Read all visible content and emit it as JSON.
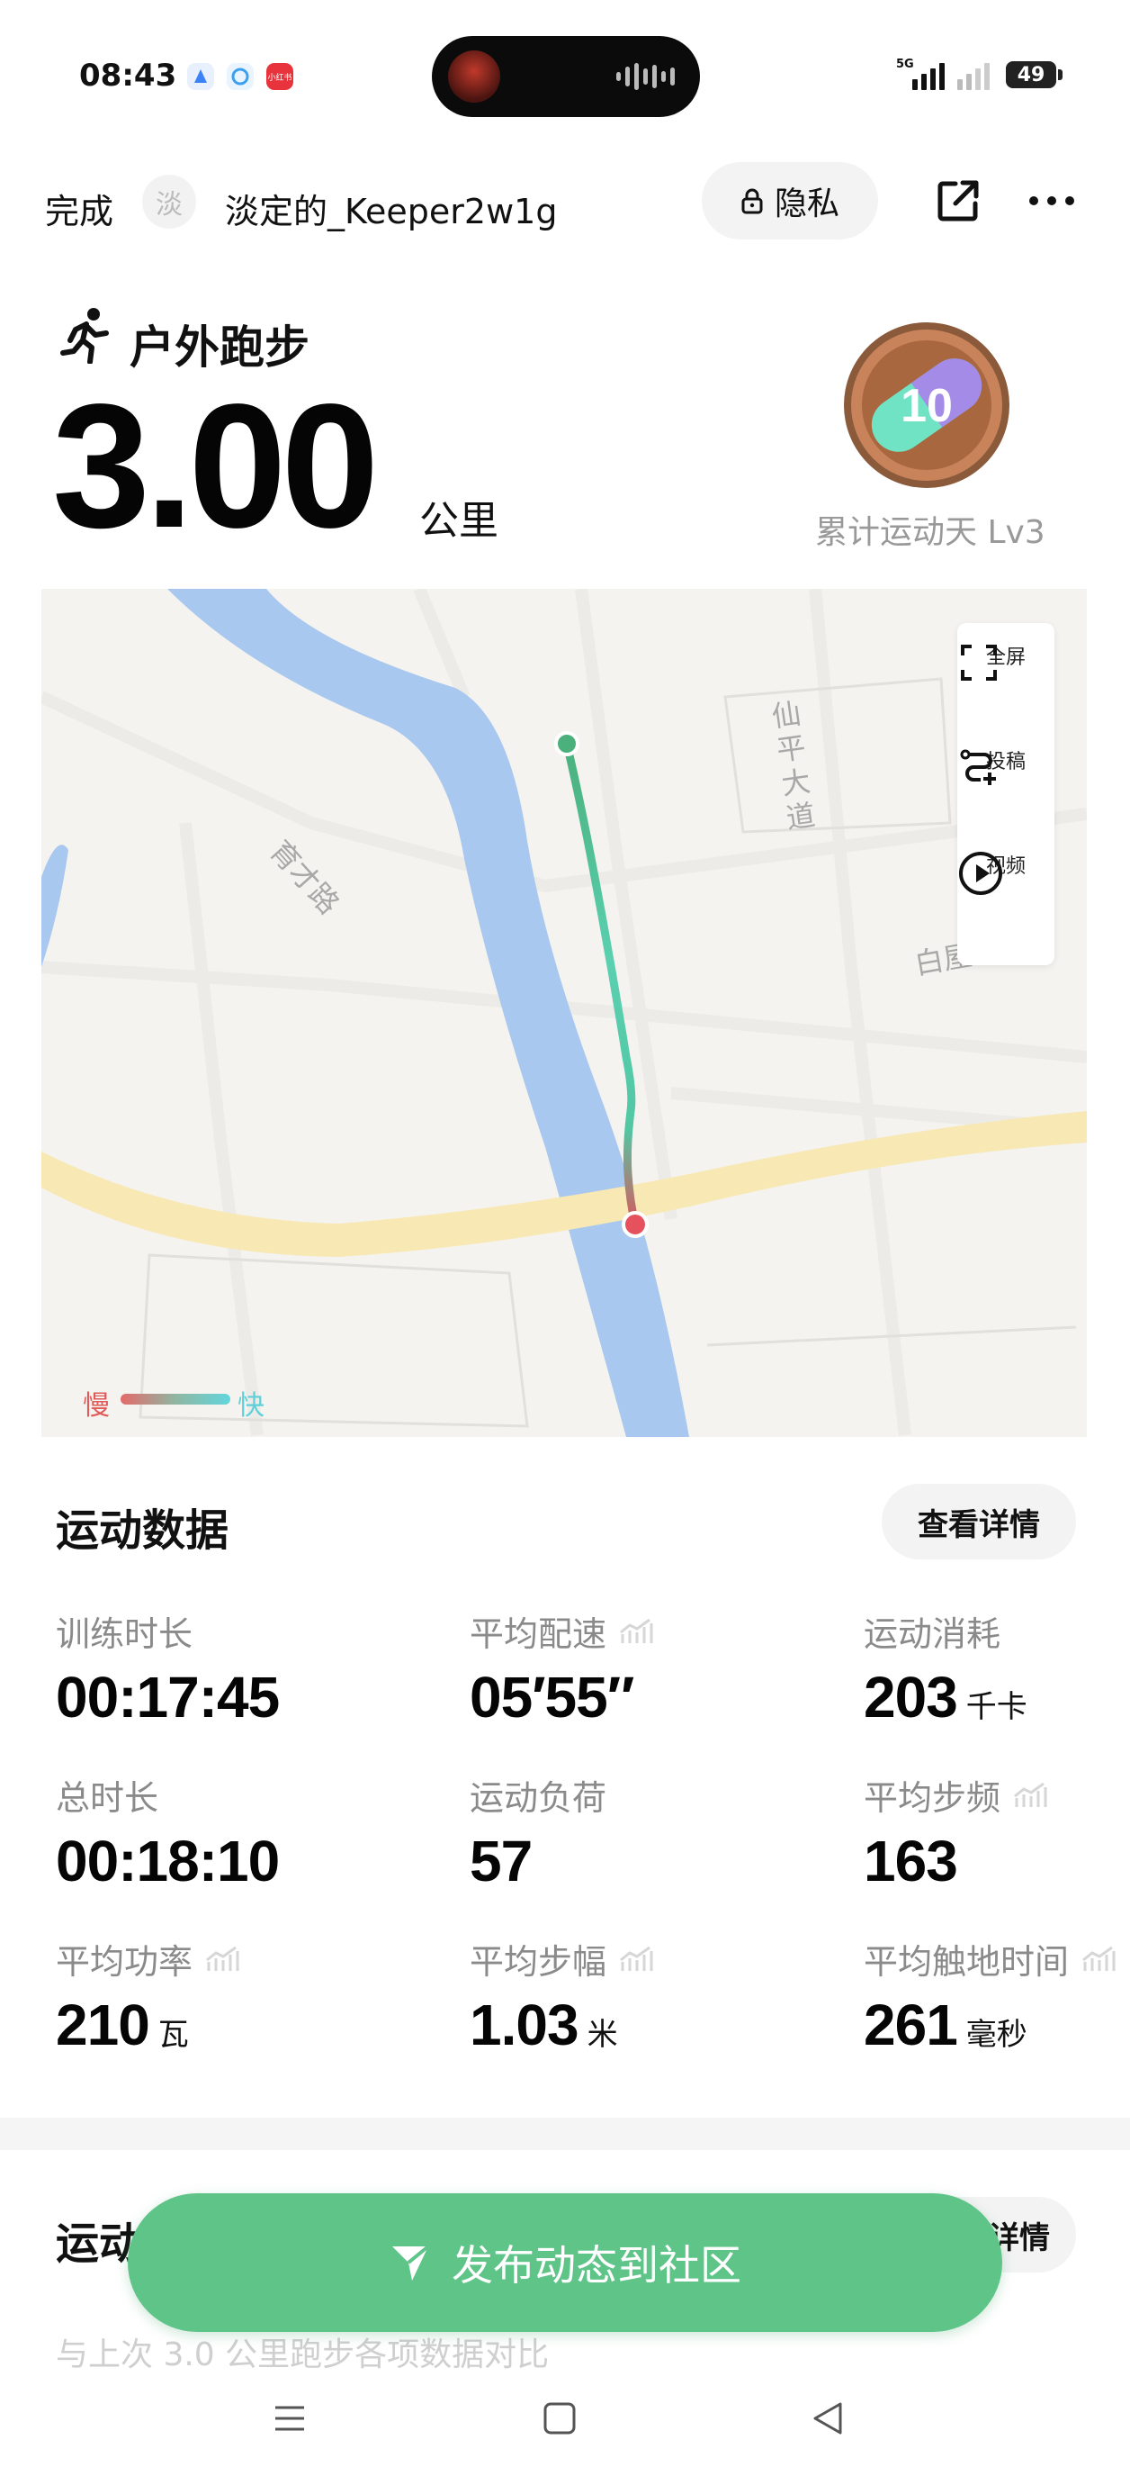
{
  "status_bar": {
    "time": "08:43",
    "network": "5G",
    "battery": "49",
    "app_icons": [
      "blue-app-icon",
      "circle-app-icon",
      "xiaohongshu-icon"
    ],
    "xhs_label": "小红书"
  },
  "nav": {
    "done_label": "完成",
    "avatar_char": "淡",
    "username": "淡定的_Keeper2w1g",
    "privacy_label": "隐私"
  },
  "workout": {
    "type_label": "户外跑步",
    "distance": "3.00",
    "distance_unit": "公里",
    "medal_label": "累计运动天 Lv3",
    "medal_text": "10"
  },
  "map": {
    "road_labels": [
      "仙平大道",
      "育才路",
      "白屋路"
    ],
    "controls": [
      "全屏",
      "投稿",
      "视频"
    ],
    "legend_slow": "慢",
    "legend_fast": "快",
    "colors": {
      "river": "#a8c8ef",
      "main_road": "#f7e8b4",
      "route_start": "#49b27a",
      "route_end": "#e5525d"
    }
  },
  "stats": {
    "section_title": "运动数据",
    "detail_label": "查看详情",
    "items": [
      {
        "label": "训练时长",
        "value": "00:17:45",
        "unit": "",
        "trend": false
      },
      {
        "label": "平均配速",
        "value": "05′55″",
        "unit": "",
        "trend": true
      },
      {
        "label": "运动消耗",
        "value": "203",
        "unit": "千卡",
        "trend": false
      },
      {
        "label": "总时长",
        "value": "00:18:10",
        "unit": "",
        "trend": false
      },
      {
        "label": "运动负荷",
        "value": "57",
        "unit": "",
        "trend": false
      },
      {
        "label": "平均步频",
        "value": "163",
        "unit": "",
        "trend": true
      },
      {
        "label": "平均功率",
        "value": "210",
        "unit": "瓦",
        "trend": true
      },
      {
        "label": "平均步幅",
        "value": "1.03",
        "unit": "米",
        "trend": true
      },
      {
        "label": "平均触地时间",
        "value": "261",
        "unit": "毫秒",
        "trend": true
      }
    ]
  },
  "compare": {
    "title_visible": "运动",
    "detail_visible": "详情",
    "subtitle": "与上次 3.0 公里跑步各项数据对比"
  },
  "publish": {
    "label": "发布动态到社区"
  },
  "system_nav": [
    "menu",
    "home",
    "back"
  ]
}
